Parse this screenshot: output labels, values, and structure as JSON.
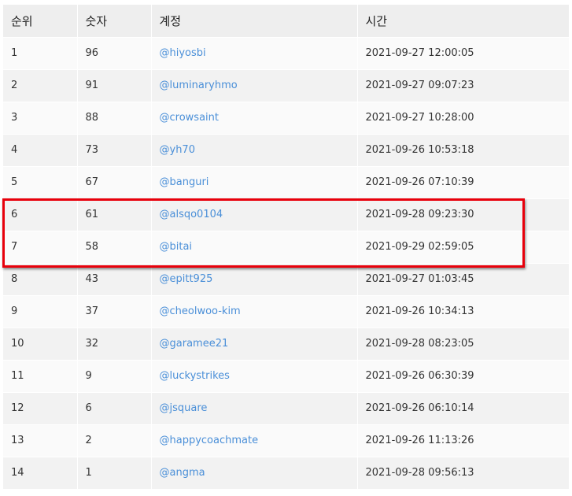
{
  "table": {
    "headers": {
      "rank": "순위",
      "number": "숫자",
      "account": "계정",
      "time": "시간"
    },
    "rows": [
      {
        "rank": "1",
        "number": "96",
        "account": "@hiyosbi",
        "time": "2021-09-27 12:00:05"
      },
      {
        "rank": "2",
        "number": "91",
        "account": "@luminaryhmo",
        "time": "2021-09-27 09:07:23"
      },
      {
        "rank": "3",
        "number": "88",
        "account": "@crowsaint",
        "time": "2021-09-27 10:28:00"
      },
      {
        "rank": "4",
        "number": "73",
        "account": "@yh70",
        "time": "2021-09-26 10:53:18"
      },
      {
        "rank": "5",
        "number": "67",
        "account": "@banguri",
        "time": "2021-09-26 07:10:39"
      },
      {
        "rank": "6",
        "number": "61",
        "account": "@alsqo0104",
        "time": "2021-09-28 09:23:30"
      },
      {
        "rank": "7",
        "number": "58",
        "account": "@bitai",
        "time": "2021-09-29 02:59:05"
      },
      {
        "rank": "8",
        "number": "43",
        "account": "@epitt925",
        "time": "2021-09-27 01:03:45"
      },
      {
        "rank": "9",
        "number": "37",
        "account": "@cheolwoo-kim",
        "time": "2021-09-26 10:34:13"
      },
      {
        "rank": "10",
        "number": "32",
        "account": "@garamee21",
        "time": "2021-09-28 08:23:05"
      },
      {
        "rank": "11",
        "number": "9",
        "account": "@luckystrikes",
        "time": "2021-09-26 06:30:39"
      },
      {
        "rank": "12",
        "number": "6",
        "account": "@jsquare",
        "time": "2021-09-26 06:10:14"
      },
      {
        "rank": "13",
        "number": "2",
        "account": "@happycoachmate",
        "time": "2021-09-26 11:13:26"
      },
      {
        "rank": "14",
        "number": "1",
        "account": "@angma",
        "time": "2021-09-28 09:56:13"
      }
    ]
  },
  "highlight": {
    "rows": [
      "6",
      "7"
    ],
    "color": "#e8000b"
  },
  "colors": {
    "link": "#4a8fd8",
    "header_bg": "#eeeeee",
    "row_odd": "#fafafa",
    "row_even": "#f2f2f2"
  }
}
